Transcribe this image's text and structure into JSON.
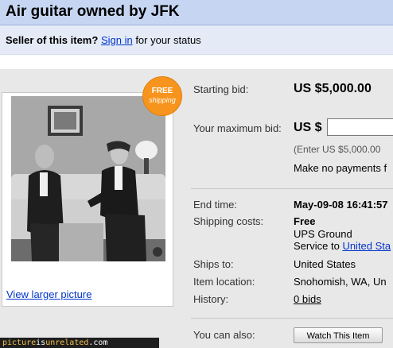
{
  "header": {
    "title": "Air guitar owned by JFK"
  },
  "seller_bar": {
    "prefix": "Seller of this item?",
    "link": "Sign in",
    "suffix": "for your status"
  },
  "badge": {
    "line1": "FREE",
    "line2": "shipping"
  },
  "photo": {
    "view_larger": "View larger picture"
  },
  "bid": {
    "starting_label": "Starting bid:",
    "starting_value": "US $5,000.00",
    "max_label": "Your maximum bid:",
    "max_prefix": "US $",
    "max_value": "",
    "hint": "(Enter US $5,000.00",
    "no_payments": "Make no payments f"
  },
  "details": {
    "end_time_label": "End time:",
    "end_time_value": "May-09-08 16:41:57",
    "shipping_label": "Shipping costs:",
    "shipping_value": "Free",
    "shipping_method": "UPS Ground",
    "service_prefix": "Service to",
    "service_link": "United Sta",
    "ships_to_label": "Ships to:",
    "ships_to_value": "United States",
    "location_label": "Item location:",
    "location_value": "Snohomish, WA, Un",
    "history_label": "History:",
    "history_link": "0 bids"
  },
  "actions": {
    "also_label": "You can also:",
    "watch_label": "Watch This Item"
  },
  "footer": {
    "part1": "picture",
    "part2": "is",
    "part3": "unrelated",
    "part4": ".com"
  },
  "colors": {
    "title_bar": "#c6d6f2",
    "seller_bar": "#e4ebf7",
    "badge": "#f7941d",
    "link": "#0033cc"
  }
}
